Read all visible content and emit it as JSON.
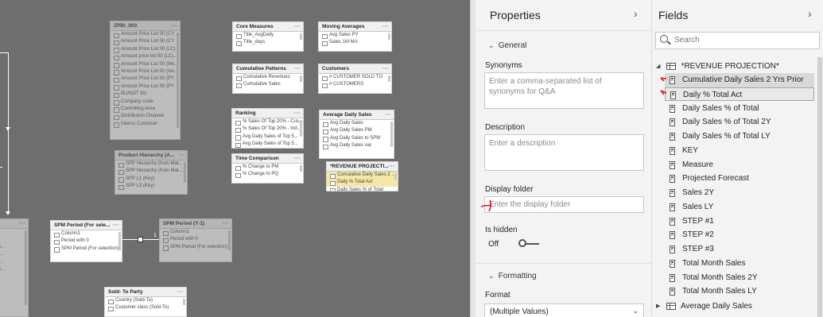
{
  "canvas": {
    "tables": [
      {
        "title": "ZPBI_003",
        "rows": [
          "Amount Price List 00 (CY ...",
          "Amount Price List 00 (CY ...",
          "Amount Price List 00 (LC)",
          "Amount price list 00 (LC)...",
          "Amount Price List 00 (Mo...",
          "Amount Price List 00 (Mo...",
          "Amount Price List 00 (PY ...",
          "Amount Price List 00 (PY ...",
          "BU/NOT BU",
          "Company code",
          "Controlling Area",
          "Distribution Channel",
          "Interco Customer"
        ]
      },
      {
        "title": "Product Hierarchy (A...",
        "rows": [
          "SPP Hierarchy (from Mat...",
          "SPP Hierarchy (from Mat...",
          "SPP L1 (Key)",
          "SPP L3 (Key)"
        ]
      },
      {
        "title": "Core Measures",
        "rows": [
          "Title_AvgDaily",
          "Title_days"
        ]
      },
      {
        "title": "Cumulative Patterns",
        "rows": [
          "Cumulative Revenues",
          "Cumulative Sales"
        ]
      },
      {
        "title": "Ranking",
        "rows": [
          "% Sales Of Top 20% - Cus...",
          "% Sales Of Top 20% - Ind...",
          "Avg Daily Sales of Top 5...",
          "Avg Daily Sales of Top 5..."
        ]
      },
      {
        "title": "Time Comparison",
        "rows": [
          "% Change to PM",
          "% Change to PQ"
        ]
      },
      {
        "title": "Moving Averages",
        "rows": [
          "Avg Sales PY",
          "Sales 1M MA"
        ]
      },
      {
        "title": "Customers",
        "rows": [
          "# CUSTOMER SOLD TO",
          "# CUSTOMERS"
        ]
      },
      {
        "title": "Average Daily Sales",
        "rows": [
          "Avg Daily Sales",
          "Avg Daily Sales PM",
          "Avg Daily Sales to SPM",
          "Avg Daily Sales var."
        ]
      },
      {
        "title": "*REVENUE PROJECTI...",
        "rows": [
          "Cumulative Daily Sales 2 ...",
          "Daily % Total Act",
          "Daily Sales % of Total"
        ]
      },
      {
        "title": "SPM Period (For sele...",
        "rows": [
          "Column1",
          "Period with 0",
          "SPM Period (For selection)"
        ]
      },
      {
        "title": "SPM Period (Y-1)",
        "rows": [
          "Column1",
          "Period with 0",
          "SPM Period (For selection)"
        ]
      },
      {
        "title": "Sold- To Party",
        "rows": [
          "Country (Sold-To)",
          "Customer class (Sold-To)"
        ]
      },
      {
        "title": "...es",
        "rows": [
          "Monthly A...",
          "rate CY",
          "ar at Dec Cl...",
          "ar at Jun Cl...",
          "ar at Mar C...",
          "ar at Sep Cl...",
          "urrency",
          "Week",
          "",
          "(Key Cy...",
          "(Key)"
        ]
      }
    ],
    "relationship_label": "1"
  },
  "properties": {
    "title": "Properties",
    "general_section": "General",
    "synonyms_label": "Synonyms",
    "synonyms_placeholder": "Enter a comma-separated list of synonyms for Q&A",
    "description_label": "Description",
    "description_placeholder": "Enter a description",
    "display_folder_label": "Display folder",
    "display_folder_placeholder": "Enter the display folder",
    "is_hidden_label": "Is hidden",
    "is_hidden_value": "Off",
    "formatting_section": "Formatting",
    "format_label": "Format",
    "format_value": "(Multiple Values)"
  },
  "fields": {
    "title": "Fields",
    "search_placeholder": "Search",
    "tables": [
      {
        "name": "*REVENUE PROJECTION*",
        "expanded": true,
        "items": [
          "Cumulative Daily Sales 2 Yrs Prior",
          "Daily % Total Act",
          "Daily Sales % of Total",
          "Daily Sales % of Total 2Y",
          "Daily Sales % of Total LY",
          "KEY",
          "Measure",
          "Projected Forecast",
          "Sales 2Y",
          "Sales LY",
          "STEP #1",
          "STEP #2",
          "STEP #3",
          "Total Month Sales",
          "Total Month Sales 2Y",
          "Total Month Sales LY"
        ]
      },
      {
        "name": "Average Daily Sales",
        "expanded": false,
        "items": []
      }
    ]
  },
  "colors": {
    "canvas_bg": "#6e6e6e",
    "pane_bg": "#f3f3f3",
    "selected_row": "#d9d9d9",
    "annotation_red": "#e8141a",
    "highlight_row": "#f3e7a6"
  },
  "icons": {
    "pane_collapse": "chevron-right-icon",
    "section_expand": "chevron-down-icon",
    "table": "table-icon",
    "measure": "calculator-icon",
    "search": "search-icon",
    "card_menu": "more-options-icon"
  }
}
